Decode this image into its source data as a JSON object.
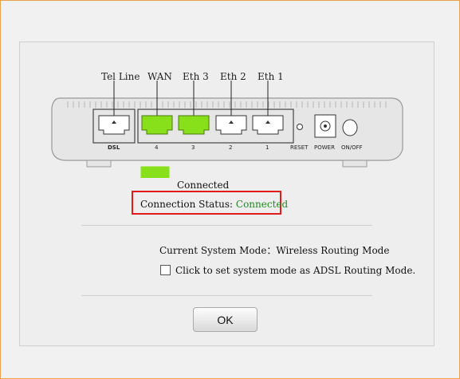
{
  "router": {
    "ports": [
      {
        "label": "Tel Line",
        "bottom": "DSL",
        "state": "disconnected"
      },
      {
        "label": "WAN",
        "bottom": "4",
        "state": "connected"
      },
      {
        "label": "Eth 3",
        "bottom": "3",
        "state": "connected"
      },
      {
        "label": "Eth 2",
        "bottom": "2",
        "state": "disconnected"
      },
      {
        "label": "Eth 1",
        "bottom": "1",
        "state": "disconnected"
      }
    ],
    "reset_label": "RESET",
    "power_label": "POWER",
    "onoff_label": "ON/OFF"
  },
  "legend": {
    "connected_text": "Connected",
    "color": "#88e01a"
  },
  "status": {
    "label": "Connection Status: ",
    "value": "Connected"
  },
  "system_mode": {
    "label": "Current System Mode：",
    "value": "Wireless Routing Mode"
  },
  "checkbox": {
    "label": "Click to set system mode as ADSL Routing Mode.",
    "checked": false
  },
  "ok_button": "OK"
}
